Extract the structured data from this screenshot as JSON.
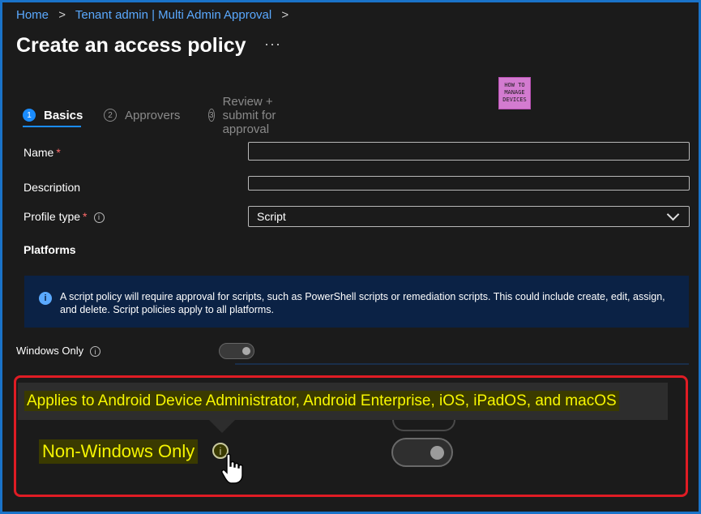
{
  "breadcrumb": {
    "items": [
      "Home",
      "Tenant admin | Multi Admin Approval"
    ],
    "separator": ">"
  },
  "page": {
    "title": "Create an access policy",
    "more_label": "···"
  },
  "logo": {
    "line1": "HOW TO",
    "line2": "MANAGE",
    "line3": "DEVICES"
  },
  "tabs": [
    {
      "number": "1",
      "label": "Basics",
      "active": true
    },
    {
      "number": "2",
      "label": "Approvers",
      "active": false
    },
    {
      "number": "3",
      "label": "Review + submit for approval",
      "active": false
    }
  ],
  "form": {
    "name_label": "Name",
    "name_value": "",
    "required_mark": "*",
    "description_label": "Description",
    "description_value": "",
    "profile_type_label": "Profile type",
    "profile_type_value": "Script",
    "platforms_label": "Platforms"
  },
  "banner": {
    "text": "A script policy will require approval for scripts, such as PowerShell scripts or remediation scripts. This could include create, edit, assign, and delete. Script policies apply to all platforms."
  },
  "windows_only": {
    "label": "Windows Only",
    "enabled": false
  },
  "zoom": {
    "tooltip_text": "Applies to Android Device Administrator, Android Enterprise, iOS, iPadOS, and macOS",
    "non_windows_label": "Non-Windows Only",
    "non_windows_enabled": false
  },
  "colors": {
    "accent": "#1a8cff",
    "link": "#5aa9ff",
    "highlight_border": "#e01c24",
    "highlight_text": "#f5f500",
    "banner_bg": "#0b2245"
  },
  "icons": [
    "info-icon",
    "chevron-down-icon",
    "hand-cursor-icon",
    "more-icon"
  ]
}
